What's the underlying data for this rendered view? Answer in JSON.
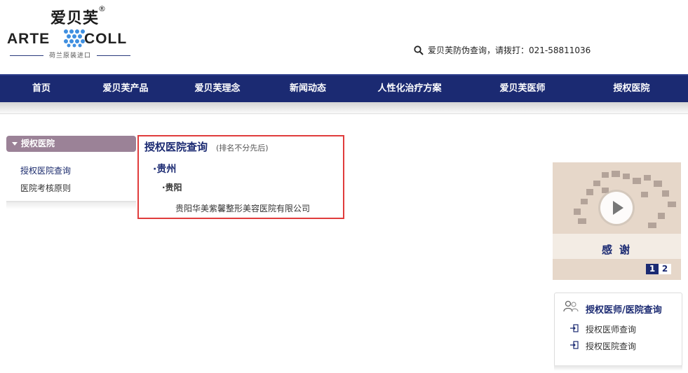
{
  "brand": {
    "cn_name": "爱贝芙",
    "registered": "®",
    "en_left": "ARTE",
    "en_right": "COLL",
    "tagline": "荷兰原装进口"
  },
  "header": {
    "hotline": "爱贝芙防伪查询，请拨打：021-58811036"
  },
  "nav": {
    "items": [
      {
        "label": "首页"
      },
      {
        "label": "爱贝芙产品"
      },
      {
        "label": "爱贝芙理念"
      },
      {
        "label": "新闻动态"
      },
      {
        "label": "人性化治疗方案"
      },
      {
        "label": "爱贝芙医师"
      },
      {
        "label": "授权医院"
      }
    ]
  },
  "sidebar": {
    "heading": "授权医院",
    "links": [
      {
        "label": "授权医院查询"
      },
      {
        "label": "医院考核原则"
      }
    ]
  },
  "result": {
    "title": "授权医院查询",
    "note": "(排名不分先后)",
    "province": "·贵州",
    "city": "·贵阳",
    "hospital": "贵阳华美紫馨整形美容医院有限公司"
  },
  "video": {
    "caption": "感谢",
    "pages": [
      "1",
      "2"
    ],
    "active_page": "1"
  },
  "query_panel": {
    "title": "授权医师/医院查询",
    "links": [
      {
        "label": "授权医师查询"
      },
      {
        "label": "授权医院查询"
      }
    ]
  },
  "colors": {
    "nav_bg": "#1b2a72",
    "sidebar_head": "#9b8297",
    "highlight_border": "#e03c3c"
  }
}
